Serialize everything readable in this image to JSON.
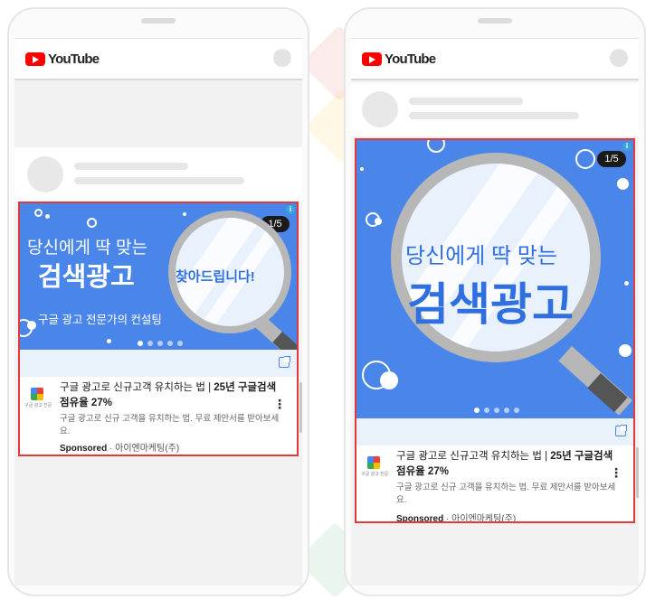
{
  "brand": {
    "name": "YouTube",
    "red": "#ff0000"
  },
  "ad": {
    "slide_counter": "1/5",
    "headline_line1": "당신에게 딱 맞는",
    "headline_line2": "검색광고",
    "callout": "찾아드립니다!",
    "subheadline": "구글 광고 전문가의 컨설팅",
    "title_normal": "구글 광고로 신규고객 유치하는 법 | ",
    "title_bold": "25년 구글검색 점유율 27%",
    "description": "구글 광고로 신규 고객을 유치하는 법. 무료 제안서를 받아보세요.",
    "sponsored_label": "Sponsored",
    "separator": " · ",
    "advertiser": "아이엔마케팅(주)",
    "advertiser_logo_caption": "구글 광고 전문",
    "info_glyph": "i",
    "more_glyph": "⋮",
    "colors": {
      "ad_blue": "#4a86ea",
      "highlight_red": "#e23a3a"
    }
  }
}
